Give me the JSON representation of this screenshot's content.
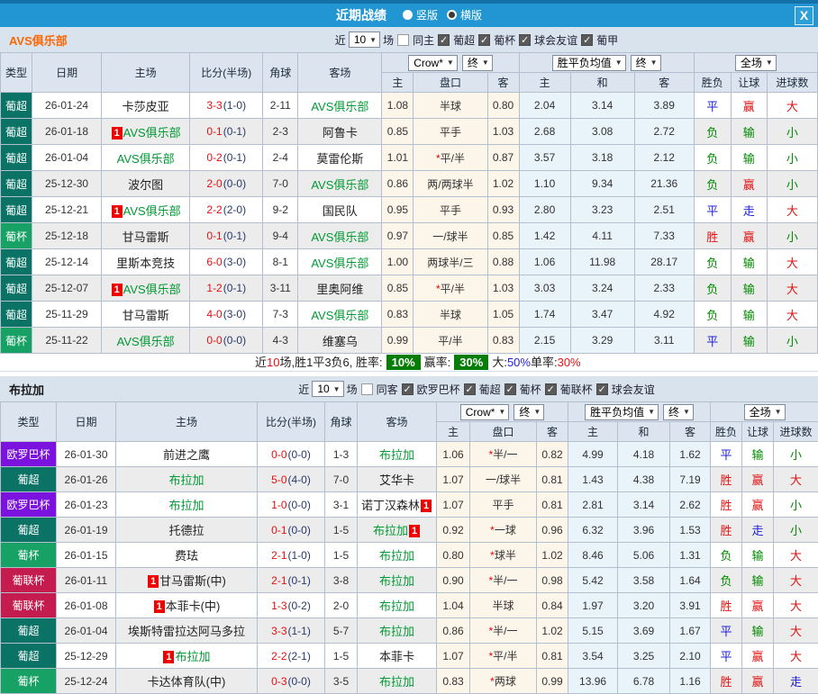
{
  "titlebar": {
    "title": "近期战绩",
    "radios": [
      {
        "key": "vertical-layout-radio",
        "label": "竖版",
        "selected": false
      },
      {
        "key": "horizontal-layout-radio",
        "label": "横版",
        "selected": true
      }
    ]
  },
  "icons": {
    "close": "X",
    "dropdown": "▼",
    "check": "✓",
    "star": "*"
  },
  "league_colors": {
    "葡超": "#0b7366",
    "葡杯": "#17a165",
    "欧罗巴杯": "#7b12dd",
    "葡联杯": "#c41c4e"
  },
  "result_colors": {
    "胜": "#e01414",
    "赢": "#e01414",
    "大": "#e01414",
    "负": "#008a00",
    "输": "#008a00",
    "小": "#008a00",
    "平": "#1f1fd8",
    "走": "#1f1fd8"
  },
  "sections": [
    {
      "team": "AVS俱乐部",
      "team_color": "#ff6600",
      "filter": {
        "prefix": "近",
        "count": "10",
        "suffix": "场",
        "same_venue": {
          "label": "同主",
          "checked": false
        },
        "leagues": [
          {
            "label": "葡超",
            "checked": true
          },
          {
            "label": "葡杯",
            "checked": true
          },
          {
            "label": "球会友谊",
            "checked": true
          },
          {
            "label": "葡甲",
            "checked": true
          }
        ]
      },
      "header": {
        "static_cols": [
          "类型",
          "日期",
          "主场",
          "比分(半场)",
          "角球",
          "客场"
        ],
        "odds_select": "Crow*",
        "odds_final": "终",
        "avg_select": "胜平负均值",
        "avg_final": "终",
        "scope_select": "全场",
        "sub_cols": [
          "主",
          "盘口",
          "客",
          "主",
          "和",
          "客",
          "胜负",
          "让球",
          "进球数"
        ]
      },
      "rows": [
        {
          "league": "葡超",
          "date": "26-01-24",
          "home": {
            "name": "卡莎皮亚",
            "focus": false,
            "card": ""
          },
          "score": "3-3",
          "half": "(1-0)",
          "corner": "2-11",
          "away": {
            "name": "AVS俱乐部",
            "focus": true,
            "card": ""
          },
          "odds": [
            "1.08",
            "半球",
            "0.80"
          ],
          "star": false,
          "avg": [
            "2.04",
            "3.14",
            "3.89"
          ],
          "results": [
            "平",
            "赢",
            "大"
          ]
        },
        {
          "league": "葡超",
          "date": "26-01-18",
          "home": {
            "name": "AVS俱乐部",
            "focus": true,
            "card": "1"
          },
          "score": "0-1",
          "half": "(0-1)",
          "corner": "2-3",
          "away": {
            "name": "阿鲁卡",
            "focus": false,
            "card": ""
          },
          "odds": [
            "0.85",
            "平手",
            "1.03"
          ],
          "star": false,
          "avg": [
            "2.68",
            "3.08",
            "2.72"
          ],
          "results": [
            "负",
            "输",
            "小"
          ]
        },
        {
          "league": "葡超",
          "date": "26-01-04",
          "home": {
            "name": "AVS俱乐部",
            "focus": true,
            "card": ""
          },
          "score": "0-2",
          "half": "(0-1)",
          "corner": "2-4",
          "away": {
            "name": "莫雷伦斯",
            "focus": false,
            "card": ""
          },
          "odds": [
            "1.01",
            "平/半",
            "0.87"
          ],
          "star": true,
          "avg": [
            "3.57",
            "3.18",
            "2.12"
          ],
          "results": [
            "负",
            "输",
            "小"
          ]
        },
        {
          "league": "葡超",
          "date": "25-12-30",
          "home": {
            "name": "波尔图",
            "focus": false,
            "card": ""
          },
          "score": "2-0",
          "half": "(0-0)",
          "corner": "7-0",
          "away": {
            "name": "AVS俱乐部",
            "focus": true,
            "card": ""
          },
          "odds": [
            "0.86",
            "两/两球半",
            "1.02"
          ],
          "star": false,
          "avg": [
            "1.10",
            "9.34",
            "21.36"
          ],
          "results": [
            "负",
            "赢",
            "小"
          ]
        },
        {
          "league": "葡超",
          "date": "25-12-21",
          "home": {
            "name": "AVS俱乐部",
            "focus": true,
            "card": "1"
          },
          "score": "2-2",
          "half": "(2-0)",
          "corner": "9-2",
          "away": {
            "name": "国民队",
            "focus": false,
            "card": ""
          },
          "odds": [
            "0.95",
            "平手",
            "0.93"
          ],
          "star": false,
          "avg": [
            "2.80",
            "3.23",
            "2.51"
          ],
          "results": [
            "平",
            "走",
            "大"
          ]
        },
        {
          "league": "葡杯",
          "date": "25-12-18",
          "home": {
            "name": "甘马雷斯",
            "focus": false,
            "card": ""
          },
          "score": "0-1",
          "half": "(0-1)",
          "corner": "9-4",
          "away": {
            "name": "AVS俱乐部",
            "focus": true,
            "card": ""
          },
          "odds": [
            "0.97",
            "一/球半",
            "0.85"
          ],
          "star": false,
          "avg": [
            "1.42",
            "4.11",
            "7.33"
          ],
          "results": [
            "胜",
            "赢",
            "小"
          ]
        },
        {
          "league": "葡超",
          "date": "25-12-14",
          "home": {
            "name": "里斯本竞技",
            "focus": false,
            "card": ""
          },
          "score": "6-0",
          "half": "(3-0)",
          "corner": "8-1",
          "away": {
            "name": "AVS俱乐部",
            "focus": true,
            "card": ""
          },
          "odds": [
            "1.00",
            "两球半/三",
            "0.88"
          ],
          "star": false,
          "avg": [
            "1.06",
            "11.98",
            "28.17"
          ],
          "results": [
            "负",
            "输",
            "大"
          ]
        },
        {
          "league": "葡超",
          "date": "25-12-07",
          "home": {
            "name": "AVS俱乐部",
            "focus": true,
            "card": "1"
          },
          "score": "1-2",
          "half": "(0-1)",
          "corner": "3-11",
          "away": {
            "name": "里奥阿维",
            "focus": false,
            "card": ""
          },
          "odds": [
            "0.85",
            "平/半",
            "1.03"
          ],
          "star": true,
          "avg": [
            "3.03",
            "3.24",
            "2.33"
          ],
          "results": [
            "负",
            "输",
            "大"
          ]
        },
        {
          "league": "葡超",
          "date": "25-11-29",
          "home": {
            "name": "甘马雷斯",
            "focus": false,
            "card": ""
          },
          "score": "4-0",
          "half": "(3-0)",
          "corner": "7-3",
          "away": {
            "name": "AVS俱乐部",
            "focus": true,
            "card": ""
          },
          "odds": [
            "0.83",
            "半球",
            "1.05"
          ],
          "star": false,
          "avg": [
            "1.74",
            "3.47",
            "4.92"
          ],
          "results": [
            "负",
            "输",
            "大"
          ]
        },
        {
          "league": "葡杯",
          "date": "25-11-22",
          "home": {
            "name": "AVS俱乐部",
            "focus": true,
            "card": ""
          },
          "score": "0-0",
          "half": "(0-0)",
          "corner": "4-3",
          "away": {
            "name": "维塞乌",
            "focus": false,
            "card": ""
          },
          "odds": [
            "0.99",
            "平/半",
            "0.83"
          ],
          "star": false,
          "avg": [
            "2.15",
            "3.29",
            "3.11"
          ],
          "results": [
            "平",
            "输",
            "小"
          ]
        }
      ],
      "summary": [
        {
          "t": "近",
          "c": "black"
        },
        {
          "t": "10",
          "c": "red"
        },
        {
          "t": "场,胜1平3负6, 胜率:",
          "c": "black"
        },
        {
          "t": "10%",
          "c": "badge"
        },
        {
          "t": "赢率:",
          "c": "black"
        },
        {
          "t": "30%",
          "c": "badge"
        },
        {
          "t": "大:",
          "c": "black"
        },
        {
          "t": "50%",
          "c": "blue"
        },
        {
          "t": "单率:",
          "c": "black"
        },
        {
          "t": "30%",
          "c": "red"
        }
      ]
    },
    {
      "team": "布拉加",
      "team_color": "#1a1a1a",
      "filter": {
        "prefix": "近",
        "count": "10",
        "suffix": "场",
        "same_venue": {
          "label": "同客",
          "checked": false
        },
        "leagues": [
          {
            "label": "欧罗巴杯",
            "checked": true
          },
          {
            "label": "葡超",
            "checked": true
          },
          {
            "label": "葡杯",
            "checked": true
          },
          {
            "label": "葡联杯",
            "checked": true
          },
          {
            "label": "球会友谊",
            "checked": true
          }
        ]
      },
      "header": {
        "static_cols": [
          "类型",
          "日期",
          "主场",
          "比分(半场)",
          "角球",
          "客场"
        ],
        "odds_select": "Crow*",
        "odds_final": "终",
        "avg_select": "胜平负均值",
        "avg_final": "终",
        "scope_select": "全场",
        "sub_cols": [
          "主",
          "盘口",
          "客",
          "主",
          "和",
          "客",
          "胜负",
          "让球",
          "进球数"
        ]
      },
      "rows": [
        {
          "league": "欧罗巴杯",
          "date": "26-01-30",
          "home": {
            "name": "前进之鹰",
            "focus": false,
            "card": ""
          },
          "score": "0-0",
          "half": "(0-0)",
          "corner": "1-3",
          "away": {
            "name": "布拉加",
            "focus": true,
            "card": ""
          },
          "odds": [
            "1.06",
            "半/一",
            "0.82"
          ],
          "star": true,
          "avg": [
            "4.99",
            "4.18",
            "1.62"
          ],
          "results": [
            "平",
            "输",
            "小"
          ]
        },
        {
          "league": "葡超",
          "date": "26-01-26",
          "home": {
            "name": "布拉加",
            "focus": true,
            "card": ""
          },
          "score": "5-0",
          "half": "(4-0)",
          "corner": "7-0",
          "away": {
            "name": "艾华卡",
            "focus": false,
            "card": ""
          },
          "odds": [
            "1.07",
            "一/球半",
            "0.81"
          ],
          "star": false,
          "avg": [
            "1.43",
            "4.38",
            "7.19"
          ],
          "results": [
            "胜",
            "赢",
            "大"
          ]
        },
        {
          "league": "欧罗巴杯",
          "date": "26-01-23",
          "home": {
            "name": "布拉加",
            "focus": true,
            "card": ""
          },
          "score": "1-0",
          "half": "(0-0)",
          "corner": "3-1",
          "away": {
            "name": "诺丁汉森林",
            "focus": false,
            "card": "1"
          },
          "odds": [
            "1.07",
            "平手",
            "0.81"
          ],
          "star": false,
          "avg": [
            "2.81",
            "3.14",
            "2.62"
          ],
          "results": [
            "胜",
            "赢",
            "小"
          ]
        },
        {
          "league": "葡超",
          "date": "26-01-19",
          "home": {
            "name": "托德拉",
            "focus": false,
            "card": ""
          },
          "score": "0-1",
          "half": "(0-0)",
          "corner": "1-5",
          "away": {
            "name": "布拉加",
            "focus": true,
            "card": "1"
          },
          "odds": [
            "0.92",
            "一球",
            "0.96"
          ],
          "star": true,
          "avg": [
            "6.32",
            "3.96",
            "1.53"
          ],
          "results": [
            "胜",
            "走",
            "小"
          ]
        },
        {
          "league": "葡杯",
          "date": "26-01-15",
          "home": {
            "name": "费珐",
            "focus": false,
            "card": ""
          },
          "score": "2-1",
          "half": "(1-0)",
          "corner": "1-5",
          "away": {
            "name": "布拉加",
            "focus": true,
            "card": ""
          },
          "odds": [
            "0.80",
            "球半",
            "1.02"
          ],
          "star": true,
          "avg": [
            "8.46",
            "5.06",
            "1.31"
          ],
          "results": [
            "负",
            "输",
            "大"
          ]
        },
        {
          "league": "葡联杯",
          "date": "26-01-11",
          "home": {
            "name": "甘马雷斯(中)",
            "focus": false,
            "card": "1"
          },
          "score": "2-1",
          "half": "(0-1)",
          "corner": "3-8",
          "away": {
            "name": "布拉加",
            "focus": true,
            "card": ""
          },
          "odds": [
            "0.90",
            "半/一",
            "0.98"
          ],
          "star": true,
          "avg": [
            "5.42",
            "3.58",
            "1.64"
          ],
          "results": [
            "负",
            "输",
            "大"
          ]
        },
        {
          "league": "葡联杯",
          "date": "26-01-08",
          "home": {
            "name": "本菲卡(中)",
            "focus": false,
            "card": "1"
          },
          "score": "1-3",
          "half": "(0-2)",
          "corner": "2-0",
          "away": {
            "name": "布拉加",
            "focus": true,
            "card": ""
          },
          "odds": [
            "1.04",
            "半球",
            "0.84"
          ],
          "star": false,
          "avg": [
            "1.97",
            "3.20",
            "3.91"
          ],
          "results": [
            "胜",
            "赢",
            "大"
          ]
        },
        {
          "league": "葡超",
          "date": "26-01-04",
          "home": {
            "name": "埃斯特雷拉达阿马多拉",
            "focus": false,
            "card": ""
          },
          "score": "3-3",
          "half": "(1-1)",
          "corner": "5-7",
          "away": {
            "name": "布拉加",
            "focus": true,
            "card": ""
          },
          "odds": [
            "0.86",
            "半/一",
            "1.02"
          ],
          "star": true,
          "avg": [
            "5.15",
            "3.69",
            "1.67"
          ],
          "results": [
            "平",
            "输",
            "大"
          ]
        },
        {
          "league": "葡超",
          "date": "25-12-29",
          "home": {
            "name": "布拉加",
            "focus": true,
            "card": "1"
          },
          "score": "2-2",
          "half": "(2-1)",
          "corner": "1-5",
          "away": {
            "name": "本菲卡",
            "focus": false,
            "card": ""
          },
          "odds": [
            "1.07",
            "平/半",
            "0.81"
          ],
          "star": true,
          "avg": [
            "3.54",
            "3.25",
            "2.10"
          ],
          "results": [
            "平",
            "赢",
            "大"
          ]
        },
        {
          "league": "葡杯",
          "date": "25-12-24",
          "home": {
            "name": "卡达体育队(中)",
            "focus": false,
            "card": ""
          },
          "score": "0-3",
          "half": "(0-0)",
          "corner": "3-5",
          "away": {
            "name": "布拉加",
            "focus": true,
            "card": ""
          },
          "odds": [
            "0.83",
            "两球",
            "0.99"
          ],
          "star": true,
          "avg": [
            "13.96",
            "6.78",
            "1.16"
          ],
          "results": [
            "胜",
            "赢",
            "走"
          ]
        }
      ],
      "summary": null
    }
  ]
}
